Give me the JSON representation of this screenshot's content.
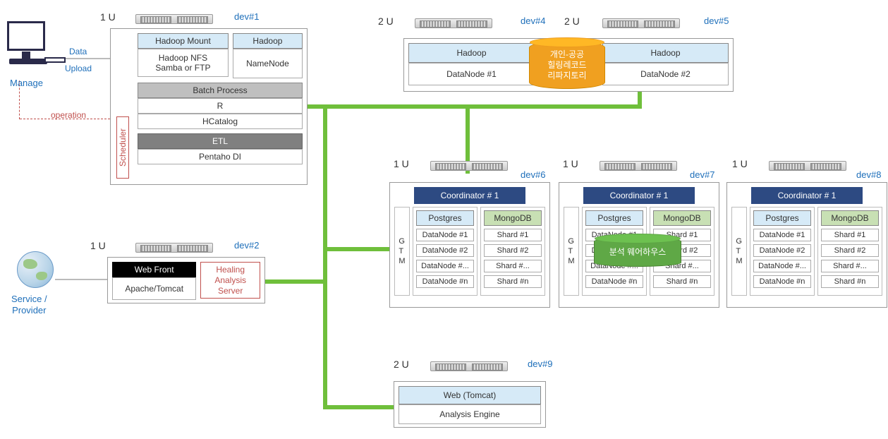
{
  "manage_label": "Manage",
  "svc_label": "Service /\nProvider",
  "data_upload_l1": "Data",
  "data_upload_l2": "Upload",
  "operation_lbl": "operation",
  "dev1": {
    "size": "1 U",
    "dev": "dev#1",
    "hadoop_mount": "Hadoop Mount",
    "hadoop": "Hadoop",
    "hadoop_nfs": "Hadoop NFS\nSamba or FTP",
    "namenode": "NameNode",
    "scheduler": "Scheduler",
    "batch": "Batch Process",
    "r": "R",
    "hcatalog": "HCatalog",
    "etl": "ETL",
    "pentaho": "Pentaho DI"
  },
  "dev2": {
    "size": "1 U",
    "dev": "dev#2",
    "webfront": "Web Front",
    "apache": "Apache/Tomcat",
    "healing": "Healing\nAnalysis\nServer"
  },
  "dev4": {
    "size": "2 U",
    "dev": "dev#4",
    "hadoop": "Hadoop",
    "dn": "DataNode #1"
  },
  "dev5": {
    "size": "2 U",
    "dev": "dev#5",
    "hadoop": "Hadoop",
    "dn": "DataNode #2"
  },
  "cyl_orange": "개인-공공\n힐링레코드\n리파지토리",
  "cyl_green": "분석 웨어하우스",
  "dev6": {
    "size": "1 U",
    "dev": "dev#6"
  },
  "dev7": {
    "size": "1 U",
    "dev": "dev#7"
  },
  "dev8": {
    "size": "1 U",
    "dev": "dev#8"
  },
  "coord": {
    "title": "Coordinator # 1",
    "postgres": "Postgres",
    "mongo": "MongoDB",
    "gtm": "G\nT\nM",
    "dn": [
      "DataNode #1",
      "DataNode #2",
      "DataNode #...",
      "DataNode #n"
    ],
    "shard": [
      "Shard #1",
      "Shard #2",
      "Shard #...",
      "Shard #n"
    ]
  },
  "dev9": {
    "size": "2 U",
    "dev": "dev#9",
    "web": "Web (Tomcat)",
    "engine": "Analysis Engine"
  }
}
